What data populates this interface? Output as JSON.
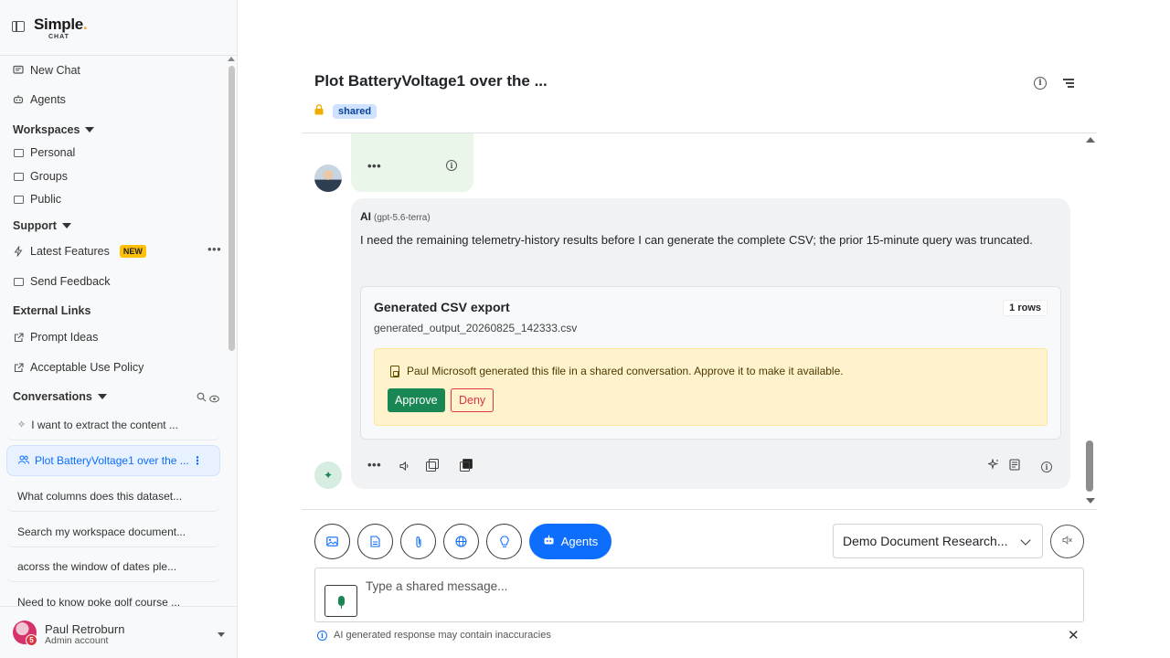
{
  "app": {
    "logo_main": "Simple",
    "logo_dot": ".",
    "logo_sub": "CHAT"
  },
  "sidebar": {
    "new_chat": "New Chat",
    "agents": "Agents",
    "workspaces_header": "Workspaces",
    "workspaces": [
      "Personal",
      "Groups",
      "Public"
    ],
    "support_header": "Support",
    "latest_features": "Latest Features",
    "new_badge": "NEW",
    "send_feedback": "Send Feedback",
    "external_links_header": "External Links",
    "prompt_ideas": "Prompt Ideas",
    "acceptable_use": "Acceptable Use Policy",
    "conversations_header": "Conversations",
    "conversations": [
      "I want to extract the content ...",
      "Plot BatteryVoltage1 over the ...",
      "What columns does this dataset...",
      "Search my workspace document...",
      "acorss the window of dates ple...",
      "Need to know poke golf course ..."
    ],
    "active_conversation_index": 1
  },
  "user": {
    "name": "Paul Retroburn",
    "role": "Admin account",
    "notification_count": "5"
  },
  "header": {
    "title": "Plot BatteryVoltage1 over the ...",
    "badge": "shared"
  },
  "message": {
    "sender": "AI",
    "model": "(gpt-5.6-terra)",
    "text": "I need the remaining telemetry-history results before I can generate the complete CSV; the prior 15-minute query was truncated."
  },
  "csv_card": {
    "title": "Generated CSV export",
    "rows_badge": "1 rows",
    "filename": "generated_output_20260825_142333.csv",
    "approval_text": "Paul Microsoft generated this file in a shared conversation. Approve it to make it available.",
    "approve_label": "Approve",
    "deny_label": "Deny"
  },
  "composer": {
    "agents_label": "Agents",
    "agent_select_value": "Demo Document Research...",
    "placeholder": "Type a shared message...",
    "disclaimer": "AI generated response may contain inaccuracies"
  },
  "colors": {
    "primary": "#0d6efd",
    "success": "#198754",
    "danger": "#dc3545",
    "warning_bg": "#fff3cd",
    "new_badge": "#ffc107"
  }
}
